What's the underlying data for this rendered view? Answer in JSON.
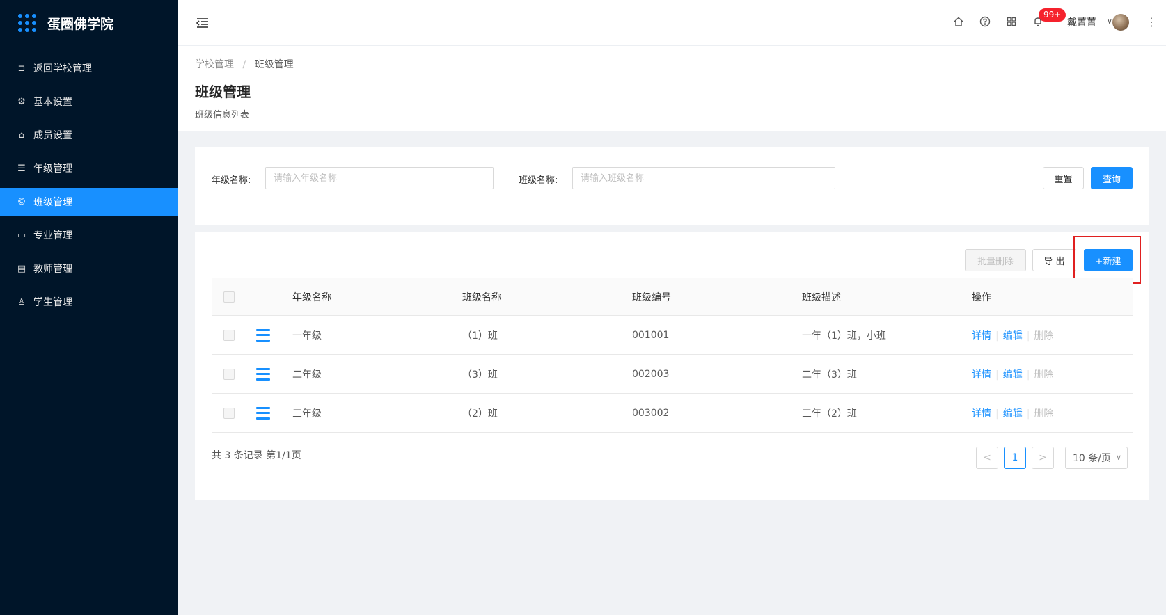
{
  "app": {
    "title": "蛋圈佛学院"
  },
  "sidebar": {
    "items": [
      {
        "label": "返回学校管理",
        "icon": "back-icon"
      },
      {
        "label": "基本设置",
        "icon": "gear-icon"
      },
      {
        "label": "成员设置",
        "icon": "home-icon"
      },
      {
        "label": "年级管理",
        "icon": "list-icon"
      },
      {
        "label": "班级管理",
        "icon": "copyright-icon",
        "active": true
      },
      {
        "label": "专业管理",
        "icon": "laptop-icon"
      },
      {
        "label": "教师管理",
        "icon": "idcard-icon"
      },
      {
        "label": "学生管理",
        "icon": "user-icon"
      }
    ]
  },
  "header": {
    "icons": [
      "menu-fold-icon",
      "home-icon",
      "question-icon",
      "apps-icon",
      "bell-icon",
      "more-icon"
    ],
    "badge": "99+",
    "user_name": "戴菁菁"
  },
  "breadcrumb": {
    "parent": "学校管理",
    "separator": "/",
    "current": "班级管理"
  },
  "page": {
    "title": "班级管理",
    "subtitle": "班级信息列表"
  },
  "search": {
    "grade_label": "年级名称:",
    "grade_placeholder": "请输入年级名称",
    "class_label": "班级名称:",
    "class_placeholder": "请输入班级名称",
    "reset_label": "重置",
    "query_label": "查询"
  },
  "toolbar": {
    "batch_delete_label": "批量删除",
    "export_label": "导 出",
    "new_label": "+新建"
  },
  "table": {
    "columns": [
      "年级名称",
      "班级名称",
      "班级编号",
      "班级描述",
      "操作"
    ],
    "rows": [
      {
        "grade": "一年级",
        "class": "（1）班",
        "code": "001001",
        "desc": "一年（1）班，小班"
      },
      {
        "grade": "二年级",
        "class": "（3）班",
        "code": "002003",
        "desc": "二年（3）班"
      },
      {
        "grade": "三年级",
        "class": "（2）班",
        "code": "003002",
        "desc": "三年（2）班"
      }
    ],
    "actions": {
      "detail": "详情",
      "edit": "编辑",
      "delete": "删除"
    }
  },
  "pagination": {
    "summary": "共 3 条记录 第1/1页",
    "prev": "<",
    "current": "1",
    "next": ">",
    "page_size": "10 条/页"
  },
  "colors": {
    "primary": "#1890ff",
    "sidebar_bg": "#001529",
    "badge": "#f5222d",
    "highlight": "#e02020"
  }
}
